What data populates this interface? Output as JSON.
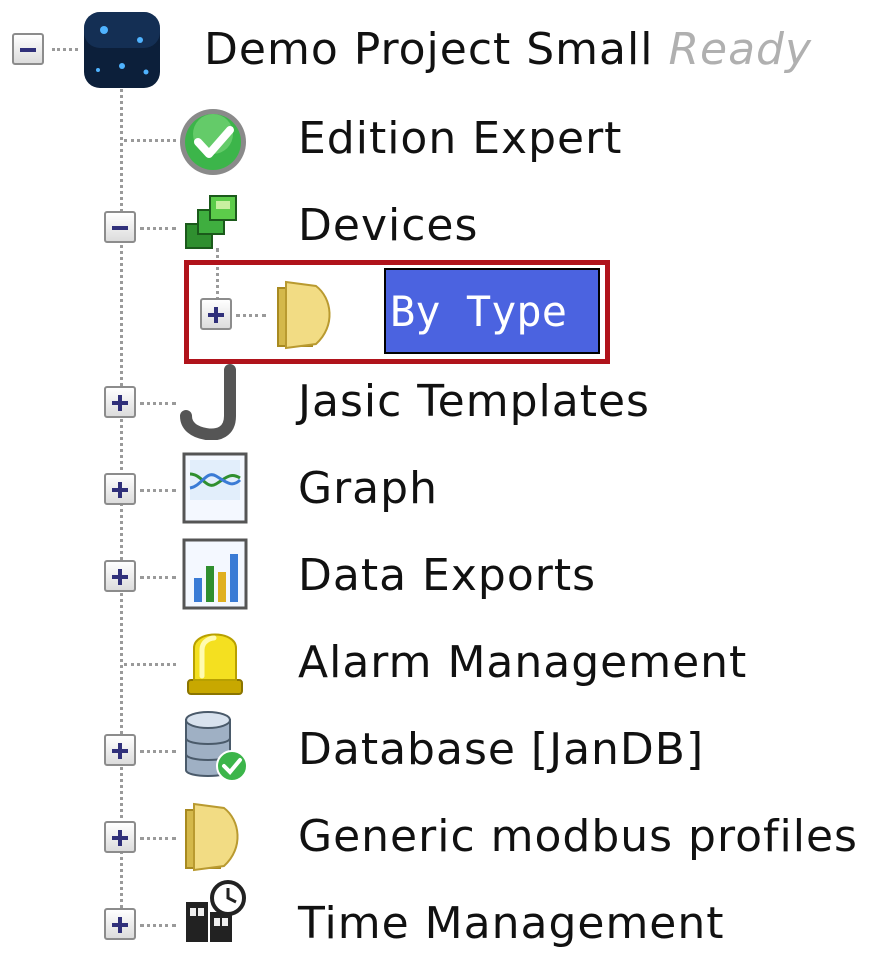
{
  "tree": {
    "root": {
      "label": "Demo Project Small",
      "status": "Ready",
      "icon": "project-icon",
      "expanded": true
    },
    "items": [
      {
        "label": "Edition Expert",
        "icon": "check-circle-icon",
        "expandable": false
      },
      {
        "label": "Devices",
        "icon": "devices-icon",
        "expandable": true,
        "expanded": true,
        "children": [
          {
            "label": "By Type",
            "icon": "folder-icon",
            "expandable": true,
            "selected": true
          }
        ]
      },
      {
        "label": "Jasic Templates",
        "icon": "jasic-icon",
        "expandable": true
      },
      {
        "label": "Graph",
        "icon": "graph-icon",
        "expandable": true
      },
      {
        "label": "Data Exports",
        "icon": "data-export-icon",
        "expandable": true
      },
      {
        "label": "Alarm Management",
        "icon": "alarm-light-icon",
        "expandable": false
      },
      {
        "label": "Database [JanDB]",
        "icon": "database-icon",
        "expandable": true
      },
      {
        "label": "Generic modbus profiles",
        "icon": "folder-icon",
        "expandable": true
      },
      {
        "label": "Time Management",
        "icon": "time-management-icon",
        "expandable": true
      }
    ]
  },
  "colors": {
    "selection": "#4b63e0",
    "highlight_border": "#b0131b",
    "status_text": "#b0b0b0"
  }
}
